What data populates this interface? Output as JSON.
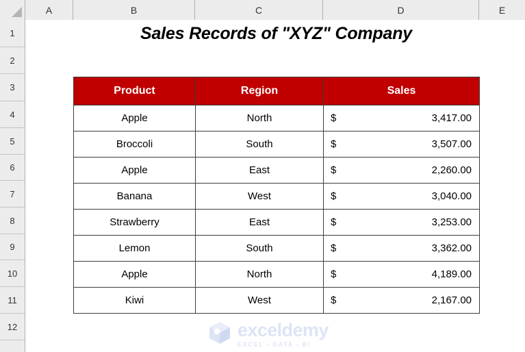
{
  "app": {
    "type": "spreadsheet",
    "gridlines_visible": false
  },
  "colors": {
    "header_fill": "#C00000",
    "header_text": "#FFFFFF",
    "cell_border": "#3C3C3C",
    "row_col_header_fill": "#ECECEC",
    "watermark": "#DDE4F4"
  },
  "column_headers": [
    {
      "label": "A"
    },
    {
      "label": "B"
    },
    {
      "label": "C"
    },
    {
      "label": "D"
    },
    {
      "label": "E"
    }
  ],
  "row_headers": [
    {
      "label": "1"
    },
    {
      "label": "2"
    },
    {
      "label": "3"
    },
    {
      "label": "4"
    },
    {
      "label": "5"
    },
    {
      "label": "6"
    },
    {
      "label": "7"
    },
    {
      "label": "8"
    },
    {
      "label": "9"
    },
    {
      "label": "10"
    },
    {
      "label": "11"
    },
    {
      "label": "12"
    }
  ],
  "title": "Sales Records of \"XYZ\" Company",
  "table": {
    "columns": [
      {
        "label": "Product"
      },
      {
        "label": "Region"
      },
      {
        "label": "Sales"
      }
    ],
    "rows": [
      {
        "product": "Apple",
        "region": "North",
        "currency": "$",
        "amount": "3,417.00"
      },
      {
        "product": "Broccoli",
        "region": "South",
        "currency": "$",
        "amount": "3,507.00"
      },
      {
        "product": "Apple",
        "region": "East",
        "currency": "$",
        "amount": "2,260.00"
      },
      {
        "product": "Banana",
        "region": "West",
        "currency": "$",
        "amount": "3,040.00"
      },
      {
        "product": "Strawberry",
        "region": "East",
        "currency": "$",
        "amount": "3,253.00"
      },
      {
        "product": "Lemon",
        "region": "South",
        "currency": "$",
        "amount": "3,362.00"
      },
      {
        "product": "Apple",
        "region": "North",
        "currency": "$",
        "amount": "4,189.00"
      },
      {
        "product": "Kiwi",
        "region": "West",
        "currency": "$",
        "amount": "2,167.00"
      }
    ]
  },
  "watermark": {
    "name": "exceldemy",
    "tagline": "EXCEL - DATA - BI"
  }
}
